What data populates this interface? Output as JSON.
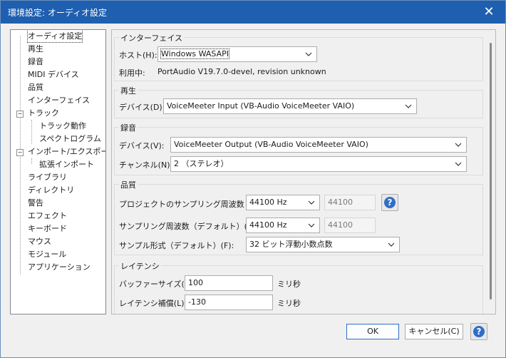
{
  "window": {
    "title": "環境設定: オーディオ設定",
    "close_glyph": "✕"
  },
  "tree": {
    "items": [
      {
        "label": "オーディオ設定"
      },
      {
        "label": "再生"
      },
      {
        "label": "録音"
      },
      {
        "label": "MIDI デバイス"
      },
      {
        "label": "品質"
      },
      {
        "label": "インターフェイス"
      },
      {
        "label": "トラック"
      },
      {
        "label": "トラック動作"
      },
      {
        "label": "スペクトログラム"
      },
      {
        "label": "インポート/エクスポート"
      },
      {
        "label": "拡張インポート"
      },
      {
        "label": "ライブラリ"
      },
      {
        "label": "ディレクトリ"
      },
      {
        "label": "警告"
      },
      {
        "label": "エフェクト"
      },
      {
        "label": "キーボード"
      },
      {
        "label": "マウス"
      },
      {
        "label": "モジュール"
      },
      {
        "label": "アプリケーション"
      }
    ],
    "expander_glyph": "−"
  },
  "interface": {
    "title": "インターフェイス",
    "host_label": "ホスト(H):",
    "host_value": "Windows WASAPI",
    "using_label": "利用中:",
    "using_value": "PortAudio V19.7.0-devel, revision unknown"
  },
  "playback": {
    "title": "再生",
    "device_label": "デバイス(D):",
    "device_value": "VoiceMeeter Input (VB-Audio VoiceMeeter VAIO)"
  },
  "recording": {
    "title": "録音",
    "device_label": "デバイス(V):",
    "device_value": "VoiceMeeter Output (VB-Audio VoiceMeeter VAIO)",
    "channels_label": "チャンネル(N):",
    "channels_value": "2 （ステレオ）"
  },
  "quality": {
    "title": "品質",
    "project_rate_label": "プロジェクトのサンプリング周波数 (P):",
    "project_rate_value": "44100 Hz",
    "project_rate_custom": "44100",
    "default_rate_label": "サンプリング周波数（デフォルト）(E):",
    "default_rate_value": "44100 Hz",
    "default_rate_custom": "44100",
    "sample_format_label": "サンプル形式（デフォルト）(F):",
    "sample_format_value": "32 ビット浮動小数点数"
  },
  "latency": {
    "title": "レイテンシ",
    "buffer_label": "バッファーサイズ(B):",
    "buffer_value": "100",
    "buffer_unit": "ミリ秒",
    "comp_label": "レイテンシ補償(L):",
    "comp_value": "-130",
    "comp_unit": "ミリ秒"
  },
  "footer": {
    "ok_label": "OK",
    "cancel_label": "キャンセル(C)"
  },
  "help_glyph": "?",
  "colors": {
    "titlebar": "#1e5faf",
    "help_icon": "#2f6ec7"
  }
}
